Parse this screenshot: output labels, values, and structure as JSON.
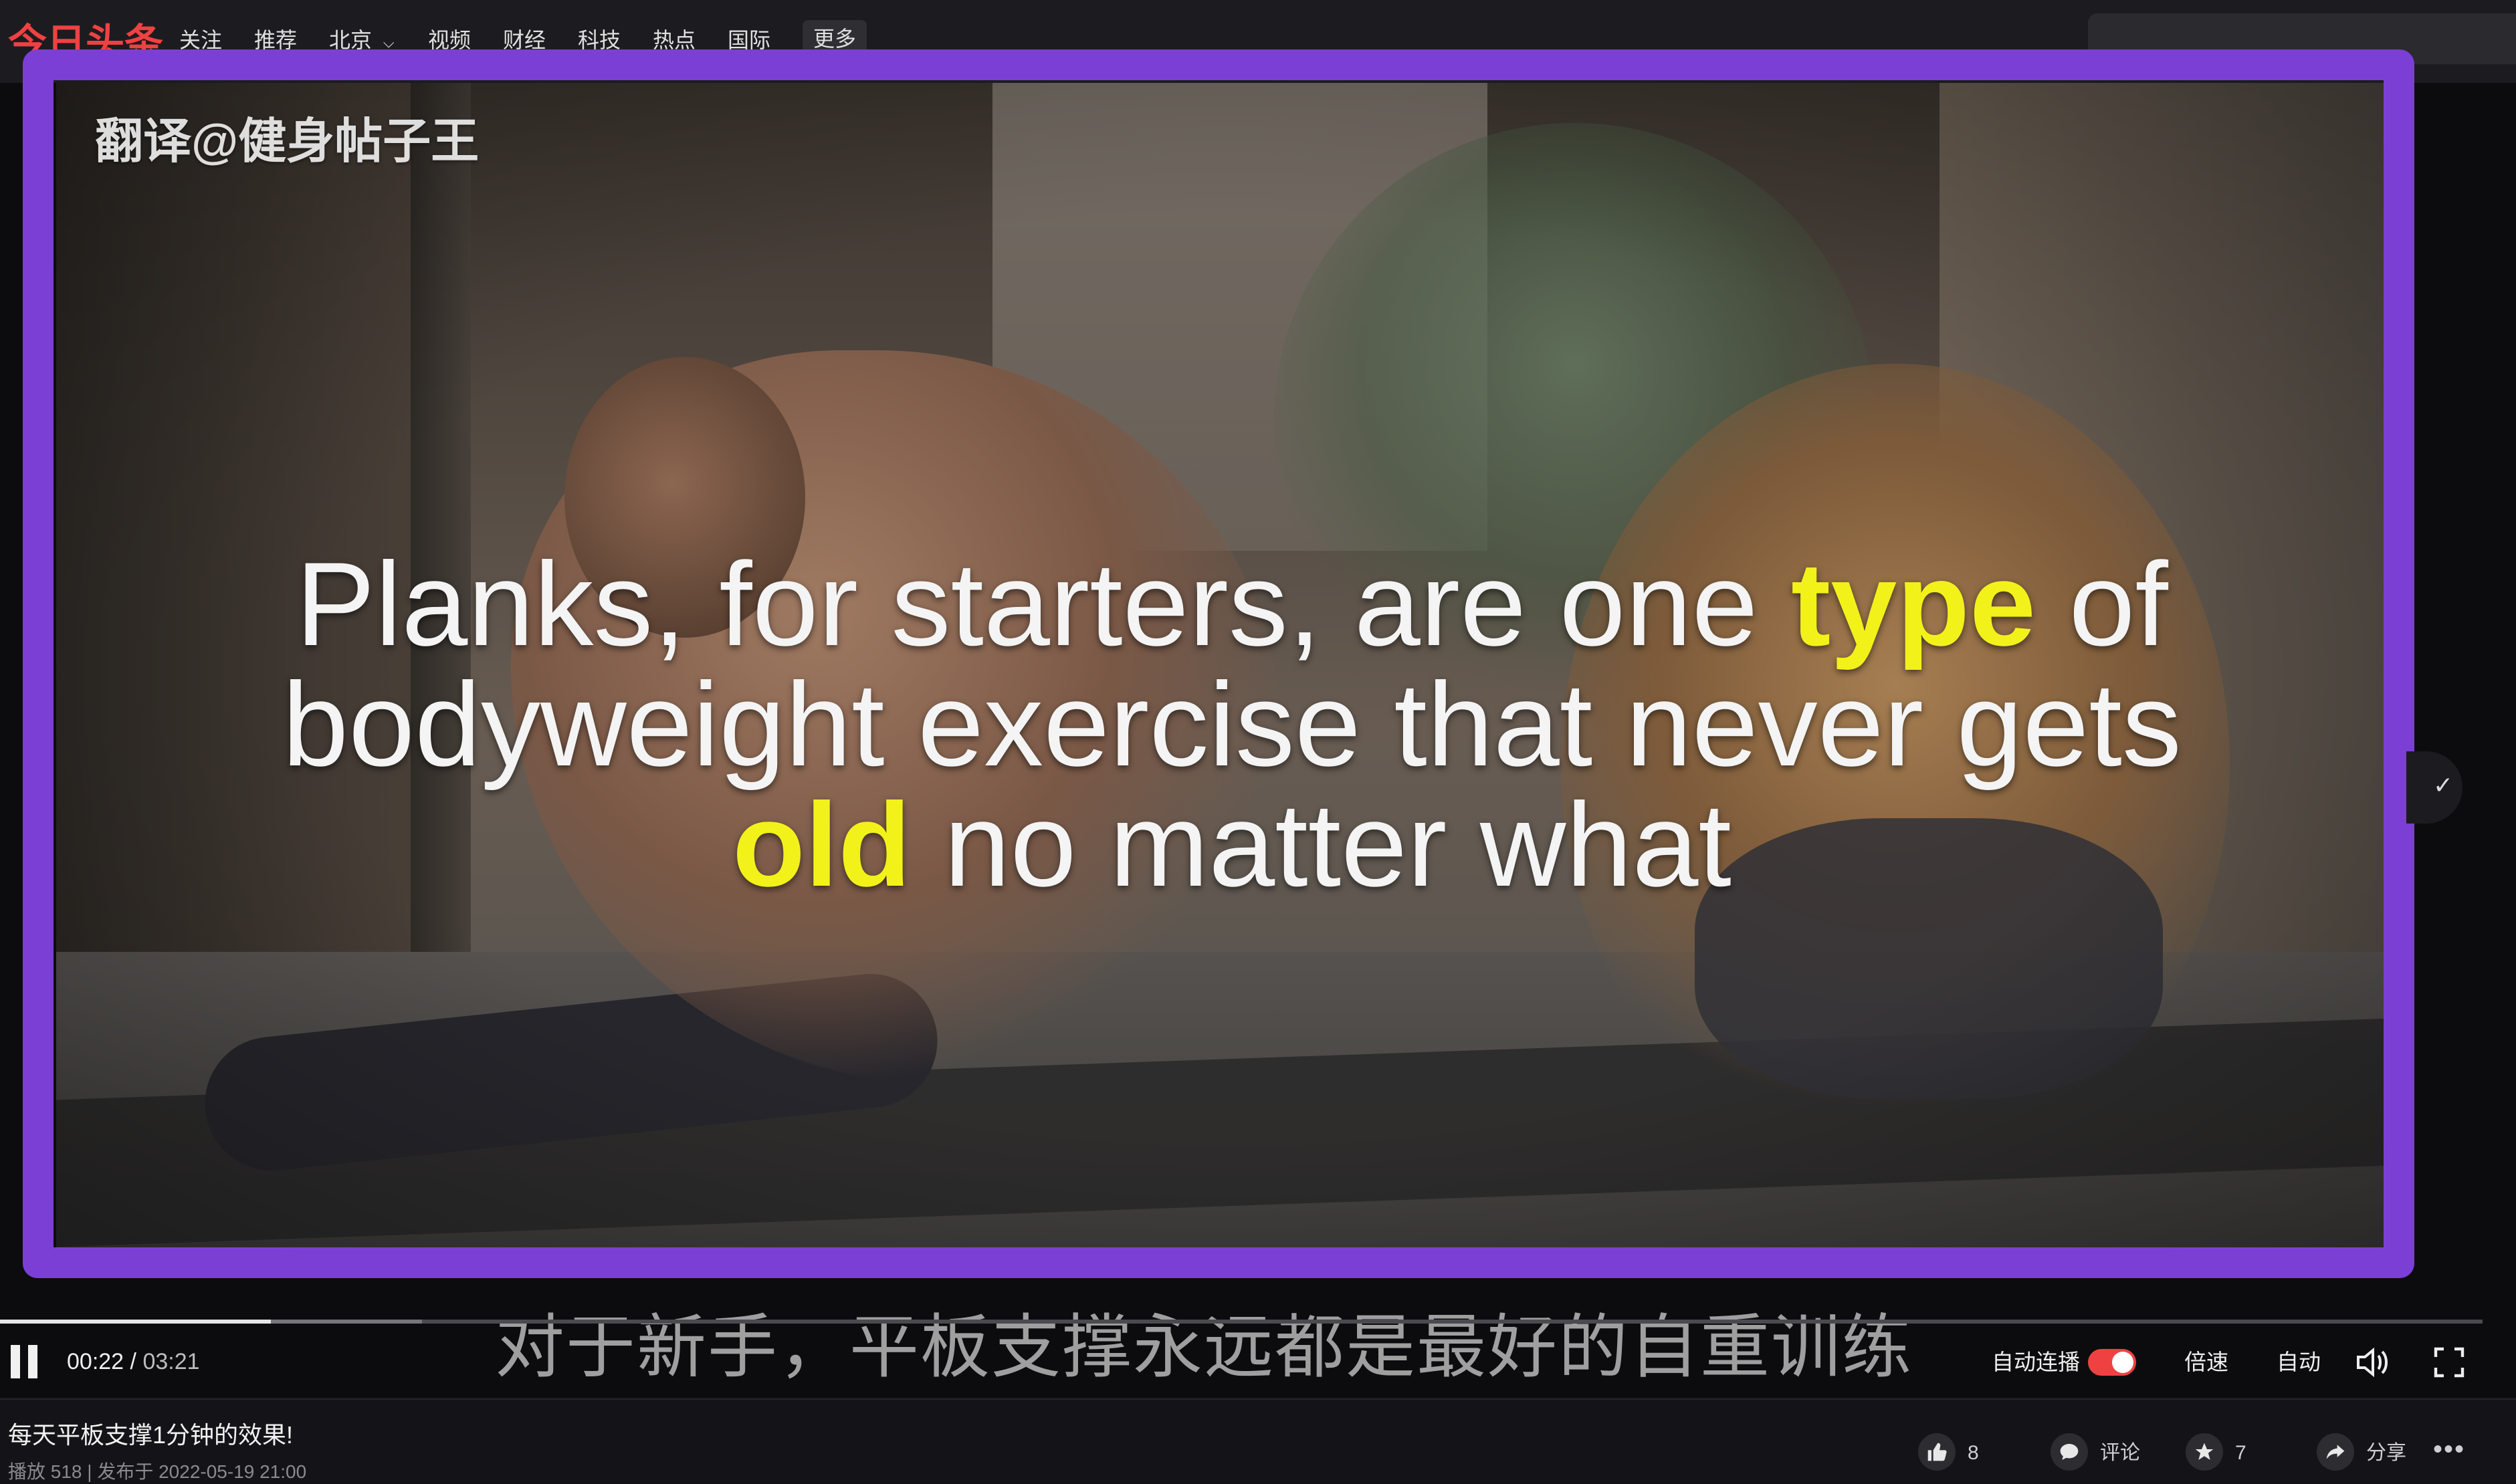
{
  "site": {
    "logo": "今日头条"
  },
  "nav": {
    "items": [
      "关注",
      "推荐",
      "北京",
      "视频",
      "财经",
      "科技",
      "热点",
      "国际"
    ],
    "more": "更多"
  },
  "video": {
    "watermark": "翻译@健身帖子王",
    "caption": {
      "l1_a": "Planks, for starters, are one ",
      "l1_hl": "type",
      "l1_b": " of",
      "l2": "bodyweight exercise that never gets",
      "l3_hl": "old",
      "l3_b": " no matter what"
    },
    "subtitle_cn": "对于新手，平板支撑永远都是最好的自重训练",
    "progress": 0.109,
    "buffered": 0.17
  },
  "controls": {
    "current_time": "00:22",
    "separator": " / ",
    "total_time": "03:21",
    "autoplay_label": "自动连播",
    "autoplay_on": true,
    "speed_label": "倍速",
    "quality_label": "自动"
  },
  "info": {
    "title": "每天平板支撑1分钟的效果!",
    "meta": "播放 518 | 发布于 2022-05-19 21:00",
    "likes": "8",
    "comment_label": "评论",
    "favorites": "7",
    "share_label": "分享"
  },
  "colors": {
    "accent": "#f04142",
    "selection_border": "#7b3fd6",
    "caption_highlight": "#f2f21a"
  }
}
